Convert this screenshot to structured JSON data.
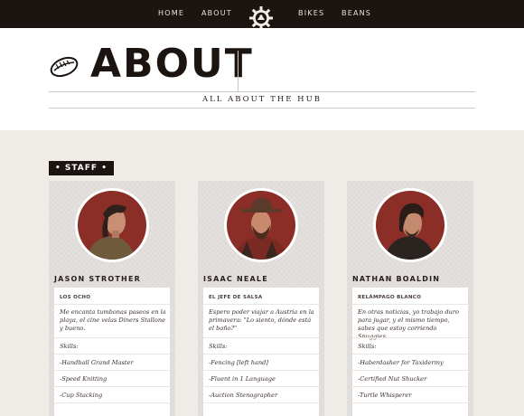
{
  "nav": {
    "left": [
      "HOME",
      "ABOUT"
    ],
    "right": [
      "BIKES",
      "BEANS"
    ],
    "logo_icon": "gear-cog-logo-icon"
  },
  "header": {
    "title": "ABOUT",
    "tagline": "ALL ABOUT THE HUB",
    "title_icon": "coffee-bean-icon"
  },
  "staff": {
    "badge": "• STAFF •",
    "members": [
      {
        "name": "JASON STROTHER",
        "role": "LOS OCHO",
        "description": "Me encanta tumbonas paseos en la playa, el cine velas Diners Stallone y bueno.",
        "skills_label": "Skills:",
        "skills": [
          "-Handball Grand Master",
          "-Speed Knitting",
          "-Cup Stacking"
        ]
      },
      {
        "name": "ISAAC NEALE",
        "role": "EL JEFE DE SALSA",
        "description": "Espero poder viajar a Austria en la primavera: \"Lo siento, dónde está el baño?\"",
        "skills_label": "Skills:",
        "skills": [
          "-Fencing [left hand]",
          "-Fluent in 1 Language",
          "-Auction Stenographer"
        ]
      },
      {
        "name": "NATHAN BOALDIN",
        "role": "RELÁMPAGO BLANCO",
        "description": "En otras noticias, yo trabajo duro para jugar, y el mismo tiempo, sabes que estoy corriendo Snuggies.",
        "skills_label": "Skills:",
        "skills": [
          "-Haberdasher for Taxidermy",
          "-Certified Nut Shucker",
          "-Turtle Whisperer"
        ]
      }
    ]
  },
  "colors": {
    "nav_bg": "#1c1411",
    "page_bg": "#efebe6",
    "avatar_bg": "#8a2e27"
  }
}
